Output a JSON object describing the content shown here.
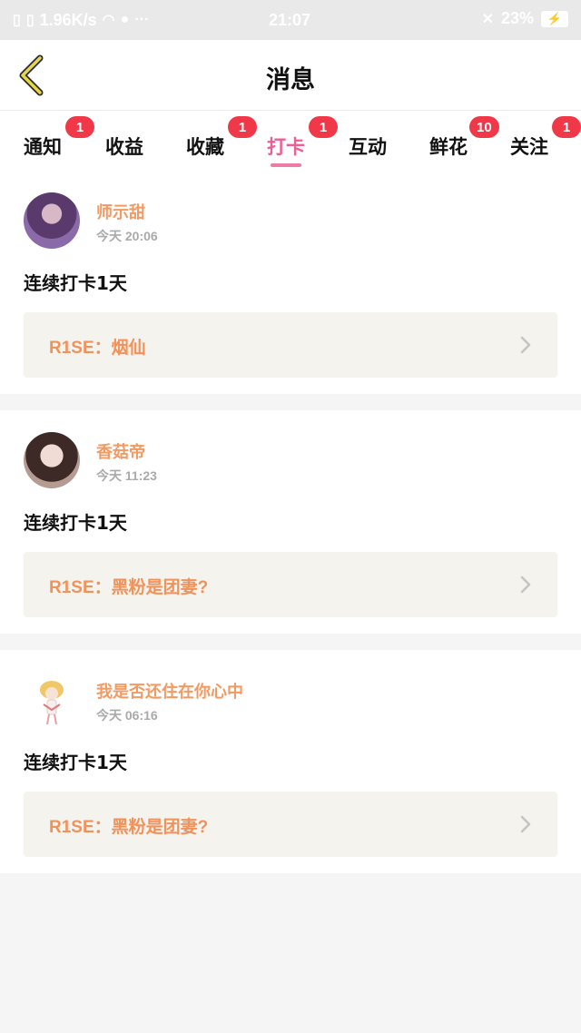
{
  "status_bar": {
    "net_speed": "1.96K/s",
    "clock": "21:07",
    "battery": "23%"
  },
  "header": {
    "back_icon": "chevron-left-icon",
    "title": "消息",
    "accent": "#e8d64a"
  },
  "tabs": [
    {
      "label": "通知",
      "badge": "1",
      "active": false
    },
    {
      "label": "收益",
      "badge": "",
      "active": false
    },
    {
      "label": "收藏",
      "badge": "1",
      "active": false
    },
    {
      "label": "打卡",
      "badge": "1",
      "active": true
    },
    {
      "label": "互动",
      "badge": "",
      "active": false
    },
    {
      "label": "鲜花",
      "badge": "10",
      "active": false
    },
    {
      "label": "关注",
      "badge": "1",
      "active": false
    }
  ],
  "colors": {
    "active_tab": "#ee5e95",
    "badge": "#f03848",
    "username": "#f39a63",
    "ref_text": "#f2925b",
    "ref_bg": "#f4f3ed"
  },
  "cards": [
    {
      "username": "师示甜",
      "time": "今天 20:06",
      "content": "连续打卡1天",
      "ref": "R1SE：烟仙"
    },
    {
      "username": "香菇帝",
      "time": "今天 11:23",
      "content": "连续打卡1天",
      "ref": "R1SE：黑粉是团妻?"
    },
    {
      "username": "我是否还住在你心中",
      "time": "今天 06:16",
      "content": "连续打卡1天",
      "ref": "R1SE：黑粉是团妻?"
    }
  ]
}
